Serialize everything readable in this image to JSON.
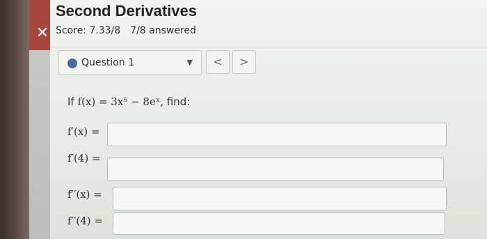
{
  "header": {
    "title": "Second Derivatives",
    "score": "Score: 7.33/8",
    "answered": "7/8 answered",
    "close_glyph": "✕"
  },
  "question_nav": {
    "selected": "Question 1",
    "prev_glyph": "<",
    "next_glyph": ">",
    "dot_color": "#4a6b9c"
  },
  "problem": {
    "prefix": "If ",
    "function": "f(x) = 3x⁵ − 8eˣ",
    "suffix": ", find:"
  },
  "answers": [
    {
      "label": "f′(x) =",
      "value": ""
    },
    {
      "label": "f′(4) =",
      "value": ""
    },
    {
      "label": "f′′(x) =",
      "value": ""
    },
    {
      "label": "f′′(4) =",
      "value": ""
    }
  ]
}
